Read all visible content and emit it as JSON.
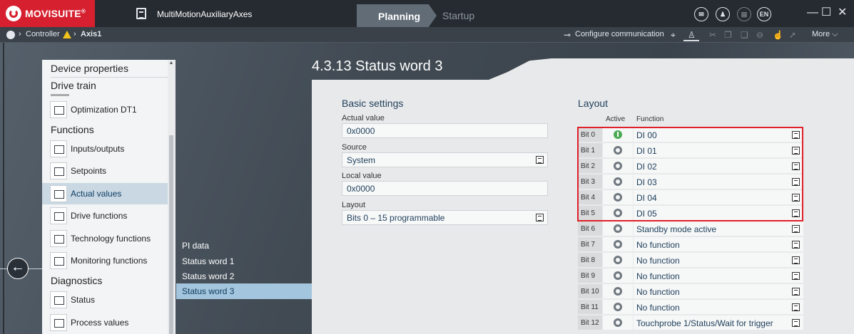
{
  "app": {
    "brand": "MOVISUITE",
    "brand_mark": "®",
    "project": "MultiMotionAuxiliaryAxes"
  },
  "modes": {
    "planning": "Planning",
    "startup": "Startup"
  },
  "header_icons": {
    "language": "EN"
  },
  "breadcrumb": {
    "controller": "Controller",
    "axis": "Axis1"
  },
  "toolbar": {
    "configure": "Configure communication",
    "more": "More"
  },
  "nav": {
    "device_properties": "Device properties",
    "drive_train": "Drive train",
    "optimization": "Optimization DT1",
    "functions": "Functions",
    "items": [
      "Inputs/outputs",
      "Setpoints",
      "Actual values",
      "Drive functions",
      "Technology functions",
      "Monitoring functions"
    ],
    "diagnostics": "Diagnostics",
    "diag_items": [
      "Status",
      "Process values"
    ]
  },
  "subnav": [
    "PI data",
    "Status word 1",
    "Status word 2",
    "Status word 3"
  ],
  "page": {
    "title": "4.3.13 Status word 3"
  },
  "basic": {
    "title": "Basic settings",
    "actual_label": "Actual value",
    "actual_value": "0x0000",
    "source_label": "Source",
    "source_value": "System",
    "local_label": "Local value",
    "local_value": "0x0000",
    "layout_label": "Layout",
    "layout_value": "Bits 0 – 15 programmable"
  },
  "layout": {
    "title": "Layout",
    "col_active": "Active",
    "col_function": "Function",
    "rows": [
      {
        "bit": "Bit 0",
        "fn": "DI 00",
        "active": true
      },
      {
        "bit": "Bit 1",
        "fn": "DI 01",
        "active": false
      },
      {
        "bit": "Bit 2",
        "fn": "DI 02",
        "active": false
      },
      {
        "bit": "Bit 3",
        "fn": "DI 03",
        "active": false
      },
      {
        "bit": "Bit 4",
        "fn": "DI 04",
        "active": false
      },
      {
        "bit": "Bit 5",
        "fn": "DI 05",
        "active": false
      },
      {
        "bit": "Bit 6",
        "fn": "Standby mode active",
        "active": false
      },
      {
        "bit": "Bit 7",
        "fn": "No function",
        "active": false
      },
      {
        "bit": "Bit 8",
        "fn": "No function",
        "active": false
      },
      {
        "bit": "Bit 9",
        "fn": "No function",
        "active": false
      },
      {
        "bit": "Bit 10",
        "fn": "No function",
        "active": false
      },
      {
        "bit": "Bit 11",
        "fn": "No function",
        "active": false
      },
      {
        "bit": "Bit 12",
        "fn": "Touchprobe 1/Status/Wait for trigger",
        "active": false
      }
    ]
  },
  "colors": {
    "brand_red": "#d6202f",
    "highlight": "#e0202a",
    "active_green": "#4caa54",
    "selected_nav": "#c9d8e2"
  }
}
